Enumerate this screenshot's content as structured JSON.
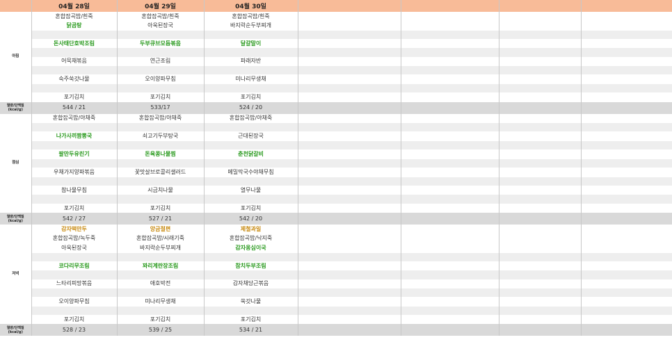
{
  "headers": [
    "",
    "04월 28일",
    "04월 29일",
    "04월 30일",
    "",
    "",
    "",
    ""
  ],
  "totals_label_line1": "열량/단백질",
  "totals_label_line2": "(kcal/g)",
  "meals": [
    {
      "label": "아침",
      "rows": [
        {
          "t": "d",
          "c": [
            {
              "v": "혼합잡곡밥/흰죽"
            },
            {
              "v": "혼합잡곡밥/흰죽"
            },
            {
              "v": "혼합잡곡밥/흰죽"
            }
          ]
        },
        {
          "t": "d",
          "c": [
            {
              "v": "닭곰탕",
              "s": "g"
            },
            {
              "v": "아욱된장국"
            },
            {
              "v": "바지락순두부찌개"
            }
          ]
        },
        {
          "t": "g"
        },
        {
          "t": "d",
          "c": [
            {
              "v": "돈사태단호박조림",
              "s": "g"
            },
            {
              "v": "두부큐브모듬볶음",
              "s": "g"
            },
            {
              "v": "달걀말이",
              "s": "g"
            }
          ]
        },
        {
          "t": "g"
        },
        {
          "t": "d",
          "c": [
            {
              "v": "어묵채볶음"
            },
            {
              "v": "연근조림"
            },
            {
              "v": "파래자반"
            }
          ]
        },
        {
          "t": "g"
        },
        {
          "t": "d",
          "c": [
            {
              "v": "숙주쑥갓나물"
            },
            {
              "v": "오이양파무침"
            },
            {
              "v": "미나리무생채"
            }
          ]
        },
        {
          "t": "g"
        },
        {
          "t": "d",
          "c": [
            {
              "v": "포기김치"
            },
            {
              "v": "포기김치"
            },
            {
              "v": "포기김치"
            }
          ]
        }
      ],
      "totals": [
        "544 / 21",
        "533/17",
        "524 / 20"
      ]
    },
    {
      "label": "점심",
      "rows": [
        {
          "t": "d",
          "c": [
            {
              "v": "혼합잡곡밥/야채죽"
            },
            {
              "v": "혼합잡곡밥/야채죽"
            },
            {
              "v": "혼합잡곡밥/야채죽"
            }
          ]
        },
        {
          "t": "g"
        },
        {
          "t": "d",
          "c": [
            {
              "v": "나가사끼짬뽕국",
              "s": "g"
            },
            {
              "v": "쇠고기두부탕국"
            },
            {
              "v": "근대된장국"
            }
          ]
        },
        {
          "t": "g"
        },
        {
          "t": "d",
          "c": [
            {
              "v": "팔만두유린기",
              "s": "g"
            },
            {
              "v": "돈육콩나물찜",
              "s": "g"
            },
            {
              "v": "춘천닭갈비",
              "s": "g"
            }
          ]
        },
        {
          "t": "g"
        },
        {
          "t": "d",
          "c": [
            {
              "v": "우채가지양파볶음"
            },
            {
              "v": "꽃맛살브로콜리샐러드"
            },
            {
              "v": "메밀막국수야채무침"
            }
          ]
        },
        {
          "t": "g"
        },
        {
          "t": "d",
          "c": [
            {
              "v": "참나물무침"
            },
            {
              "v": "시금치나물"
            },
            {
              "v": "열무나물"
            }
          ]
        },
        {
          "t": "g"
        },
        {
          "t": "d",
          "c": [
            {
              "v": "포기김치"
            },
            {
              "v": "포기김치"
            },
            {
              "v": "포기김치"
            }
          ]
        }
      ],
      "totals": [
        "542 / 27",
        "527 / 21",
        "542 / 20"
      ]
    },
    {
      "label": "저녁",
      "rows": [
        {
          "t": "d",
          "c": [
            {
              "v": "감자떡만두",
              "s": "o"
            },
            {
              "v": "앙금절편",
              "s": "o"
            },
            {
              "v": "제철과일",
              "s": "o"
            }
          ]
        },
        {
          "t": "d",
          "c": [
            {
              "v": "혼합잡곡밥/녹두죽"
            },
            {
              "v": "혼합잡곡밥/시래기죽"
            },
            {
              "v": "혼합잡곡밥/낙지죽"
            }
          ]
        },
        {
          "t": "d",
          "c": [
            {
              "v": "아욱된장국"
            },
            {
              "v": "바지락순두부찌개"
            },
            {
              "v": "감자옹심이국",
              "s": "g"
            }
          ]
        },
        {
          "t": "g"
        },
        {
          "t": "d",
          "c": [
            {
              "v": "코다리무조림",
              "s": "g"
            },
            {
              "v": "꽈리계란장조림",
              "s": "g"
            },
            {
              "v": "참치두부조림",
              "s": "g"
            }
          ]
        },
        {
          "t": "g"
        },
        {
          "t": "d",
          "c": [
            {
              "v": "느타리피망볶음"
            },
            {
              "v": "애호박전"
            },
            {
              "v": "감자채당근볶음"
            }
          ]
        },
        {
          "t": "g"
        },
        {
          "t": "d",
          "c": [
            {
              "v": "오이양파무침"
            },
            {
              "v": "미나리무생채"
            },
            {
              "v": "쑥갓나물"
            }
          ]
        },
        {
          "t": "g"
        },
        {
          "t": "d",
          "c": [
            {
              "v": "포기김치"
            },
            {
              "v": "포기김치"
            },
            {
              "v": "포기김치"
            }
          ]
        }
      ],
      "totals": [
        "528 / 23",
        "539 / 25",
        "534 / 21"
      ]
    }
  ]
}
